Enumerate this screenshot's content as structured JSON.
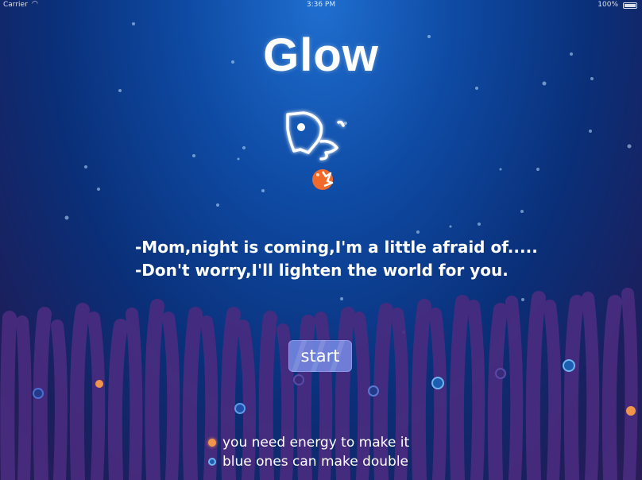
{
  "status_bar": {
    "carrier": "Carrier",
    "time": "3:36 PM",
    "battery": "100%"
  },
  "title": "Glow",
  "story": {
    "line1": "-Mom,night is coming,I'm a little afraid of.....",
    "line2": "-Don't worry,I'll lighten the world for you."
  },
  "start_button": {
    "label": "start"
  },
  "legend": [
    {
      "icon": "orange-energy-dot-icon",
      "color": "#f0954a",
      "text": "you need energy to make it"
    },
    {
      "icon": "blue-energy-dot-icon",
      "color": "#6fb4f0",
      "text": "blue ones can make double"
    }
  ],
  "colors": {
    "orange_energy": "#f0954a",
    "blue_energy": "#6fb4f0",
    "grass": "#4a2c80",
    "mascot_orange": "#f06a2c"
  }
}
